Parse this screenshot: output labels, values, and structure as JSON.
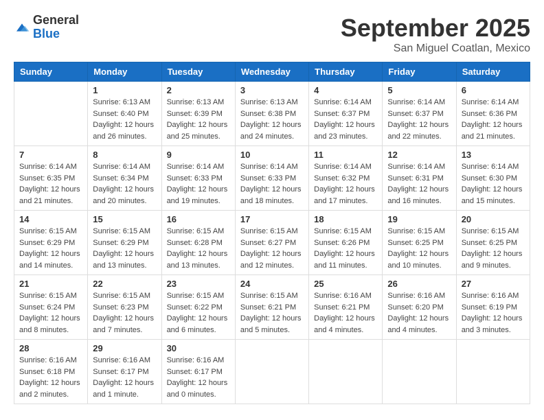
{
  "logo": {
    "general": "General",
    "blue": "Blue"
  },
  "header": {
    "month": "September 2025",
    "location": "San Miguel Coatlan, Mexico"
  },
  "weekdays": [
    "Sunday",
    "Monday",
    "Tuesday",
    "Wednesday",
    "Thursday",
    "Friday",
    "Saturday"
  ],
  "weeks": [
    [
      {
        "day": "",
        "info": ""
      },
      {
        "day": "1",
        "info": "Sunrise: 6:13 AM\nSunset: 6:40 PM\nDaylight: 12 hours\nand 26 minutes."
      },
      {
        "day": "2",
        "info": "Sunrise: 6:13 AM\nSunset: 6:39 PM\nDaylight: 12 hours\nand 25 minutes."
      },
      {
        "day": "3",
        "info": "Sunrise: 6:13 AM\nSunset: 6:38 PM\nDaylight: 12 hours\nand 24 minutes."
      },
      {
        "day": "4",
        "info": "Sunrise: 6:14 AM\nSunset: 6:37 PM\nDaylight: 12 hours\nand 23 minutes."
      },
      {
        "day": "5",
        "info": "Sunrise: 6:14 AM\nSunset: 6:37 PM\nDaylight: 12 hours\nand 22 minutes."
      },
      {
        "day": "6",
        "info": "Sunrise: 6:14 AM\nSunset: 6:36 PM\nDaylight: 12 hours\nand 21 minutes."
      }
    ],
    [
      {
        "day": "7",
        "info": "Sunrise: 6:14 AM\nSunset: 6:35 PM\nDaylight: 12 hours\nand 21 minutes."
      },
      {
        "day": "8",
        "info": "Sunrise: 6:14 AM\nSunset: 6:34 PM\nDaylight: 12 hours\nand 20 minutes."
      },
      {
        "day": "9",
        "info": "Sunrise: 6:14 AM\nSunset: 6:33 PM\nDaylight: 12 hours\nand 19 minutes."
      },
      {
        "day": "10",
        "info": "Sunrise: 6:14 AM\nSunset: 6:33 PM\nDaylight: 12 hours\nand 18 minutes."
      },
      {
        "day": "11",
        "info": "Sunrise: 6:14 AM\nSunset: 6:32 PM\nDaylight: 12 hours\nand 17 minutes."
      },
      {
        "day": "12",
        "info": "Sunrise: 6:14 AM\nSunset: 6:31 PM\nDaylight: 12 hours\nand 16 minutes."
      },
      {
        "day": "13",
        "info": "Sunrise: 6:14 AM\nSunset: 6:30 PM\nDaylight: 12 hours\nand 15 minutes."
      }
    ],
    [
      {
        "day": "14",
        "info": "Sunrise: 6:15 AM\nSunset: 6:29 PM\nDaylight: 12 hours\nand 14 minutes."
      },
      {
        "day": "15",
        "info": "Sunrise: 6:15 AM\nSunset: 6:29 PM\nDaylight: 12 hours\nand 13 minutes."
      },
      {
        "day": "16",
        "info": "Sunrise: 6:15 AM\nSunset: 6:28 PM\nDaylight: 12 hours\nand 13 minutes."
      },
      {
        "day": "17",
        "info": "Sunrise: 6:15 AM\nSunset: 6:27 PM\nDaylight: 12 hours\nand 12 minutes."
      },
      {
        "day": "18",
        "info": "Sunrise: 6:15 AM\nSunset: 6:26 PM\nDaylight: 12 hours\nand 11 minutes."
      },
      {
        "day": "19",
        "info": "Sunrise: 6:15 AM\nSunset: 6:25 PM\nDaylight: 12 hours\nand 10 minutes."
      },
      {
        "day": "20",
        "info": "Sunrise: 6:15 AM\nSunset: 6:25 PM\nDaylight: 12 hours\nand 9 minutes."
      }
    ],
    [
      {
        "day": "21",
        "info": "Sunrise: 6:15 AM\nSunset: 6:24 PM\nDaylight: 12 hours\nand 8 minutes."
      },
      {
        "day": "22",
        "info": "Sunrise: 6:15 AM\nSunset: 6:23 PM\nDaylight: 12 hours\nand 7 minutes."
      },
      {
        "day": "23",
        "info": "Sunrise: 6:15 AM\nSunset: 6:22 PM\nDaylight: 12 hours\nand 6 minutes."
      },
      {
        "day": "24",
        "info": "Sunrise: 6:15 AM\nSunset: 6:21 PM\nDaylight: 12 hours\nand 5 minutes."
      },
      {
        "day": "25",
        "info": "Sunrise: 6:16 AM\nSunset: 6:21 PM\nDaylight: 12 hours\nand 4 minutes."
      },
      {
        "day": "26",
        "info": "Sunrise: 6:16 AM\nSunset: 6:20 PM\nDaylight: 12 hours\nand 4 minutes."
      },
      {
        "day": "27",
        "info": "Sunrise: 6:16 AM\nSunset: 6:19 PM\nDaylight: 12 hours\nand 3 minutes."
      }
    ],
    [
      {
        "day": "28",
        "info": "Sunrise: 6:16 AM\nSunset: 6:18 PM\nDaylight: 12 hours\nand 2 minutes."
      },
      {
        "day": "29",
        "info": "Sunrise: 6:16 AM\nSunset: 6:17 PM\nDaylight: 12 hours\nand 1 minute."
      },
      {
        "day": "30",
        "info": "Sunrise: 6:16 AM\nSunset: 6:17 PM\nDaylight: 12 hours\nand 0 minutes."
      },
      {
        "day": "",
        "info": ""
      },
      {
        "day": "",
        "info": ""
      },
      {
        "day": "",
        "info": ""
      },
      {
        "day": "",
        "info": ""
      }
    ]
  ]
}
